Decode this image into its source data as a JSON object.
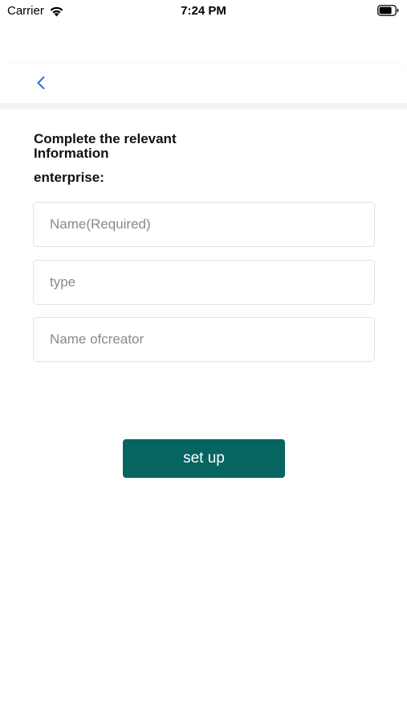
{
  "status_bar": {
    "carrier": "Carrier",
    "time": "7:24 PM",
    "icons": [
      "wifi-icon",
      "battery-icon"
    ]
  },
  "nav": {
    "back_icon": "chevron-left-icon",
    "accent_color": "#2f6fd6"
  },
  "form": {
    "heading": "Complete the relevant Information",
    "subheading": "enterprise:",
    "fields": [
      {
        "placeholder": "Name(Required)",
        "value": ""
      },
      {
        "placeholder": "type",
        "value": ""
      },
      {
        "placeholder": "Name ofcreator",
        "value": ""
      }
    ],
    "submit_label": "set up",
    "submit_color": "#066561"
  }
}
